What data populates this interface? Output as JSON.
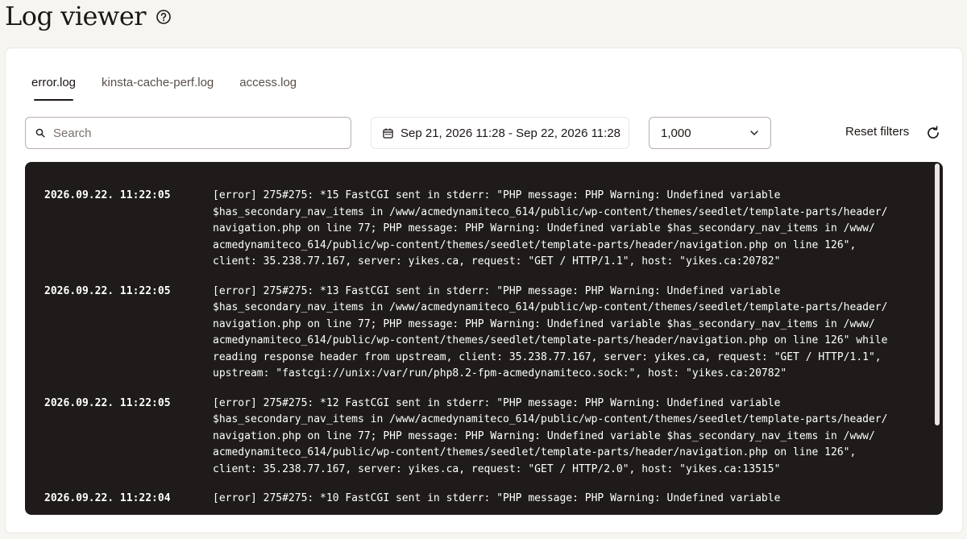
{
  "header": {
    "title": "Log viewer",
    "help_icon": "help-circle-icon"
  },
  "tabs": [
    {
      "label": "error.log",
      "active": true
    },
    {
      "label": "kinsta-cache-perf.log",
      "active": false
    },
    {
      "label": "access.log",
      "active": false
    }
  ],
  "filters": {
    "search_placeholder": "Search",
    "search_value": "",
    "date_range": "Sep 21, 2026 11:28 - Sep 22, 2026 11:28",
    "limit": "1,000",
    "reset_label": "Reset filters"
  },
  "log": {
    "entries": [
      {
        "time": "2026.09.22. 11:22:05",
        "message": "[error] 275#275: *15 FastCGI sent in stderr: \"PHP message: PHP Warning: Undefined variable\n$has_secondary_nav_items in /www/acmedynamiteco_614/public/wp-content/themes/seedlet/template-parts/header/\nnavigation.php on line 77; PHP message: PHP Warning: Undefined variable $has_secondary_nav_items in /www/\nacmedynamiteco_614/public/wp-content/themes/seedlet/template-parts/header/navigation.php on line 126\",\nclient: 35.238.77.167, server: yikes.ca, request: \"GET / HTTP/1.1\", host: \"yikes.ca:20782\""
      },
      {
        "time": "2026.09.22. 11:22:05",
        "message": "[error] 275#275: *13 FastCGI sent in stderr: \"PHP message: PHP Warning: Undefined variable\n$has_secondary_nav_items in /www/acmedynamiteco_614/public/wp-content/themes/seedlet/template-parts/header/\nnavigation.php on line 77; PHP message: PHP Warning: Undefined variable $has_secondary_nav_items in /www/\nacmedynamiteco_614/public/wp-content/themes/seedlet/template-parts/header/navigation.php on line 126\" while\nreading response header from upstream, client: 35.238.77.167, server: yikes.ca, request: \"GET / HTTP/1.1\",\nupstream: \"fastcgi://unix:/var/run/php8.2-fpm-acmedynamiteco.sock:\", host: \"yikes.ca:20782\""
      },
      {
        "time": "2026.09.22. 11:22:05",
        "message": "[error] 275#275: *12 FastCGI sent in stderr: \"PHP message: PHP Warning: Undefined variable\n$has_secondary_nav_items in /www/acmedynamiteco_614/public/wp-content/themes/seedlet/template-parts/header/\nnavigation.php on line 77; PHP message: PHP Warning: Undefined variable $has_secondary_nav_items in /www/\nacmedynamiteco_614/public/wp-content/themes/seedlet/template-parts/header/navigation.php on line 126\",\nclient: 35.238.77.167, server: yikes.ca, request: \"GET / HTTP/2.0\", host: \"yikes.ca:13515\""
      },
      {
        "time": "2026.09.22. 11:22:04",
        "message": "[error] 275#275: *10 FastCGI sent in stderr: \"PHP message: PHP Warning: Undefined variable"
      }
    ]
  }
}
